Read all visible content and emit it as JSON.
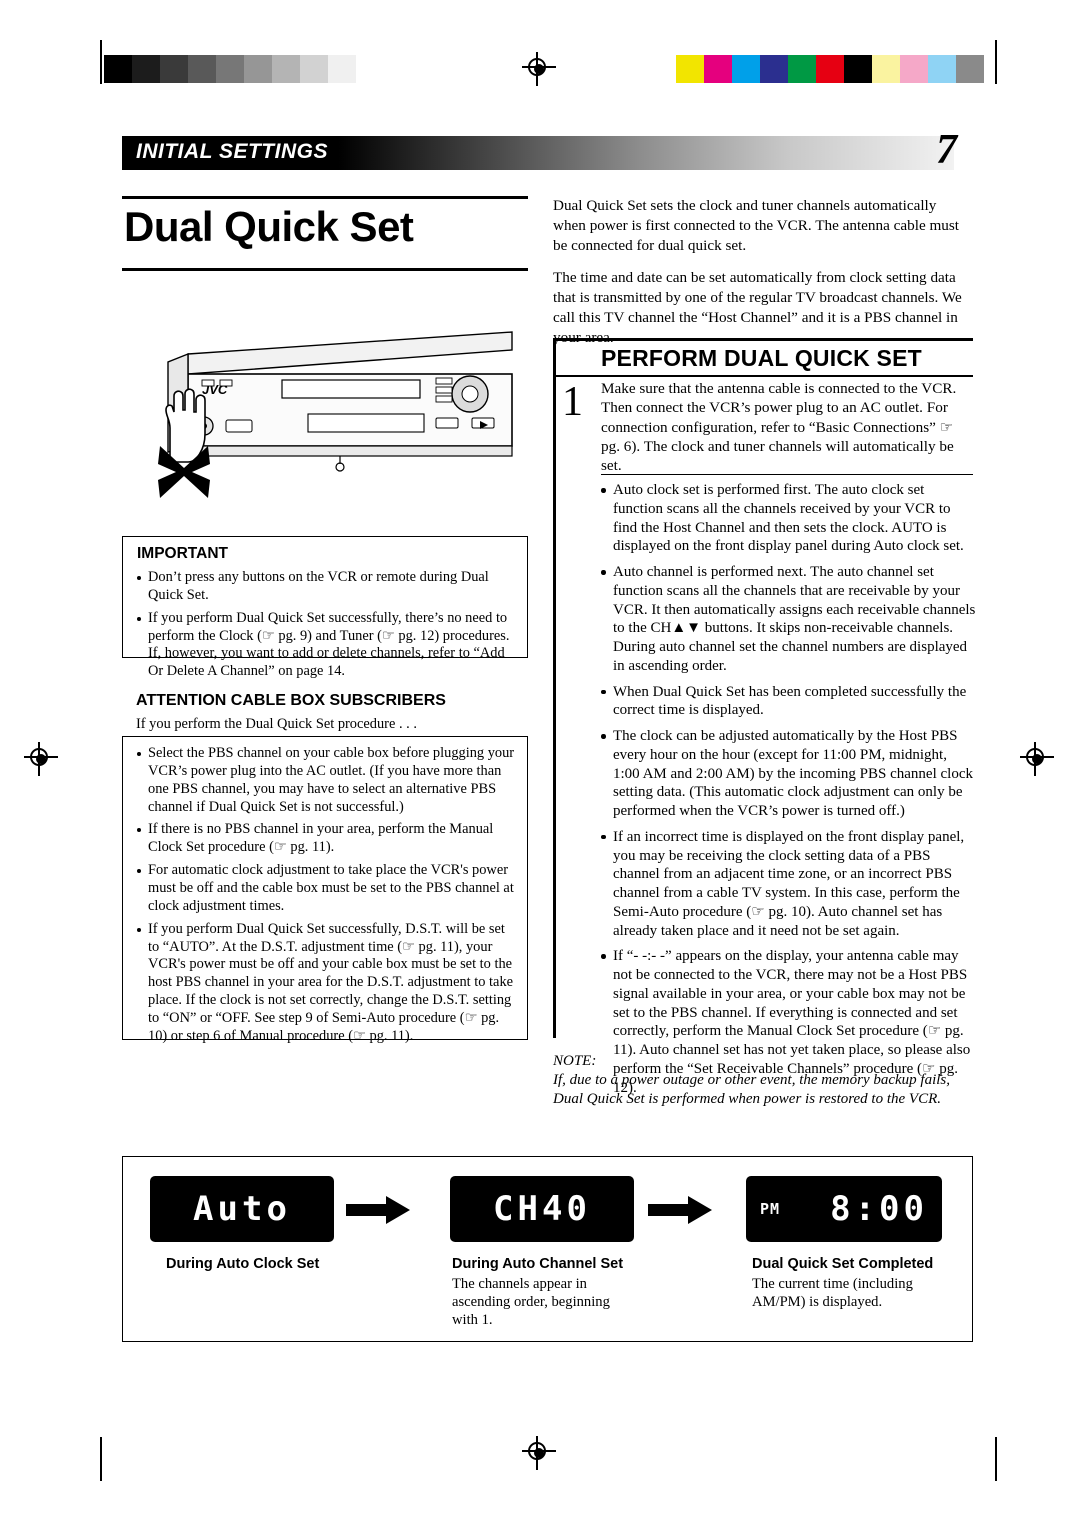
{
  "header": {
    "section": "INITIAL SETTINGS",
    "page_number": "7"
  },
  "title": "Dual Quick Set",
  "intro": {
    "p1": "Dual Quick Set sets the clock and tuner channels automatically when power is first connected to the VCR. The antenna cable must be connected for dual quick set.",
    "p2": "The time and date can be set automatically from clock setting data that is transmitted by one of the regular TV broadcast channels. We call this TV channel the “Host Channel” and it is a PBS channel in your area."
  },
  "vcr": {
    "brand": "JVC"
  },
  "important": {
    "heading": "IMPORTANT",
    "bullets": [
      "Don’t press any buttons on the VCR or remote during Dual Quick Set.",
      "If you perform Dual Quick Set successfully, there’s no need to perform the Clock (☞ pg. 9) and Tuner (☞ pg. 12) procedures. If, however, you want to add or delete channels, refer to “Add Or Delete A Channel” on page 14."
    ]
  },
  "attention": {
    "heading": "ATTENTION CABLE BOX SUBSCRIBERS",
    "subhead": "If you perform the Dual Quick Set procedure . . .",
    "bullets": [
      "Select the PBS channel on your cable box before plugging your VCR’s power plug into the AC outlet. (If you have more than one PBS channel, you may have to select an alternative PBS channel if Dual Quick Set is not successful.)",
      "If there is no PBS channel in your area, perform the Manual Clock Set procedure (☞ pg. 11).",
      "For automatic clock adjustment to take place the VCR's power must be off and the cable box must be set to the PBS channel at clock adjustment times.",
      "If you perform Dual Quick Set successfully, D.S.T. will be set to “AUTO”. At the D.S.T. adjustment time (☞ pg. 11), your VCR's power must be off and your cable box must be set to the host PBS channel in your area for the D.S.T. adjustment to take place. If the clock is not set correctly, change the D.S.T. setting to “ON” or “OFF. See step 9 of Semi-Auto procedure (☞ pg. 10) or step 6 of Manual procedure (☞ pg. 11)."
    ]
  },
  "step": {
    "number": "1",
    "heading": "PERFORM DUAL QUICK SET",
    "body": "Make sure that the antenna cable is connected to the VCR. Then connect the VCR’s power plug to an AC outlet. For connection configuration, refer to “Basic Connections” ☞ pg. 6). The clock and tuner channels will automatically be set.",
    "bullets": [
      "Auto clock set is performed first. The auto clock set function scans all the channels received by your VCR to find the Host Channel and then sets the clock. AUTO is displayed on the front display panel during Auto clock set.",
      "Auto channel is performed next. The auto channel set function scans all the channels that are receivable by your VCR. It then automatically assigns each receivable channels to the CH▲▼ buttons. It skips non-receivable channels. During auto channel set the channel numbers are displayed in ascending order.",
      "When Dual Quick Set has been completed successfully the correct time is displayed.",
      "The clock can be adjusted automatically by the Host PBS every hour on the hour (except for 11:00 PM, midnight, 1:00 AM and 2:00 AM) by the incoming PBS channel clock setting data. (This automatic clock adjustment can only be performed when the VCR’s power is turned off.)",
      "If an incorrect time is displayed on the front display panel, you may be receiving the clock setting data of a PBS channel from an adjacent time zone, or an incorrect PBS channel from a cable TV system. In this case, perform the Semi-Auto procedure (☞ pg. 10). Auto channel set has already taken place and it need not be set again.",
      "If “- -:- -” appears on the display, your antenna cable may not be connected to the VCR, there may not be a Host PBS signal available in your area, or your cable box may not be set to the PBS channel. If everything is connected and set correctly, perform the Manual Clock Set procedure (☞ pg. 11). Auto channel set has not yet taken place, so please also perform the “Set Receivable Channels” procedure (☞ pg. 12)."
    ]
  },
  "note": {
    "label": "NOTE:",
    "text": "If, due to a power outage or other event, the memory backup fails, Dual Quick Set is performed when power is restored to the VCR."
  },
  "displays": [
    {
      "segment": "Auto",
      "caption_bold": "During Auto Clock Set",
      "caption_body": ""
    },
    {
      "segment": "CH40",
      "caption_bold": "During Auto Channel Set",
      "caption_body": "The channels appear in ascending order, beginning with 1."
    },
    {
      "segment": "8:00",
      "ampm": "PM",
      "caption_bold": "Dual Quick Set Completed",
      "caption_body": "The current time (including AM/PM) is displayed."
    }
  ],
  "colors": {
    "calibration_gray": [
      "#000000",
      "#1c1c1c",
      "#3a3a3a",
      "#595959",
      "#777777",
      "#969696",
      "#b4b4b4",
      "#d2d2d2",
      "#f0f0f0"
    ],
    "calibration_color": [
      "#f2e500",
      "#e5007e",
      "#00a0e9",
      "#2b2f8f",
      "#009944",
      "#e60012",
      "#000000",
      "#faf3a0",
      "#f5a8c8",
      "#8fd3f4",
      "#8a8a8a"
    ]
  }
}
